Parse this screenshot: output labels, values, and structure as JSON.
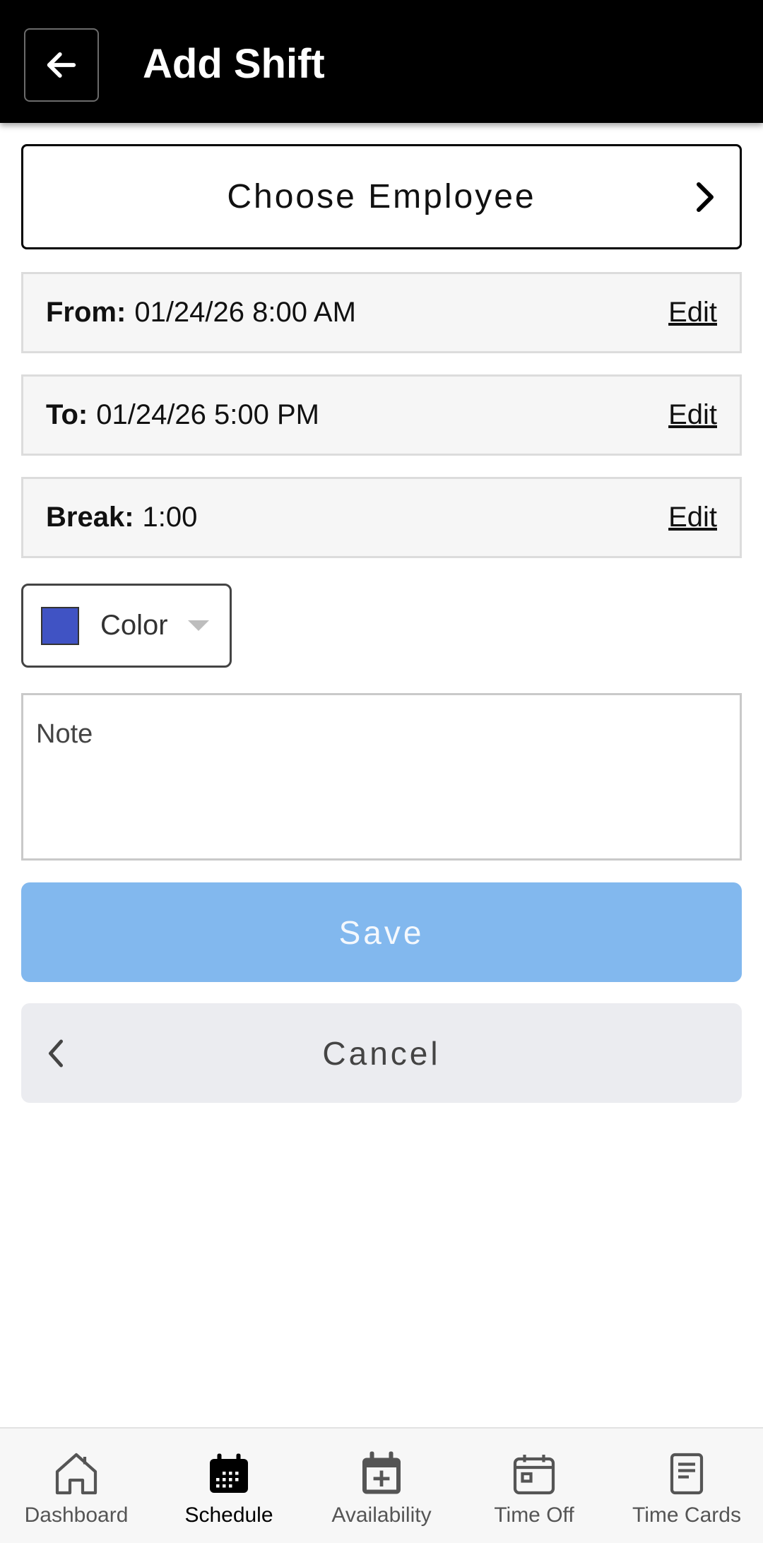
{
  "header": {
    "title": "Add Shift",
    "back_icon": "arrow-left-icon"
  },
  "employee": {
    "label": "Choose Employee",
    "icon": "chevron-right-icon"
  },
  "from": {
    "key": "From:",
    "value": "01/24/26 8:00 AM",
    "edit_label": "Edit"
  },
  "to": {
    "key": "To:",
    "value": "01/24/26 5:00 PM",
    "edit_label": "Edit"
  },
  "break": {
    "key": "Break:",
    "value": "1:00",
    "edit_label": "Edit"
  },
  "color": {
    "label": "Color",
    "swatch": "#4053c4"
  },
  "note": {
    "placeholder": "Note",
    "value": ""
  },
  "actions": {
    "save_label": "Save",
    "cancel_label": "Cancel"
  },
  "colors": {
    "header_bg": "#000000",
    "save_bg": "#82b8ee",
    "cancel_bg": "#ebecf0"
  },
  "nav": {
    "dashboard": "Dashboard",
    "schedule": "Schedule",
    "availability": "Availability",
    "time_off": "Time Off",
    "time_cards": "Time Cards",
    "active": "Schedule"
  }
}
